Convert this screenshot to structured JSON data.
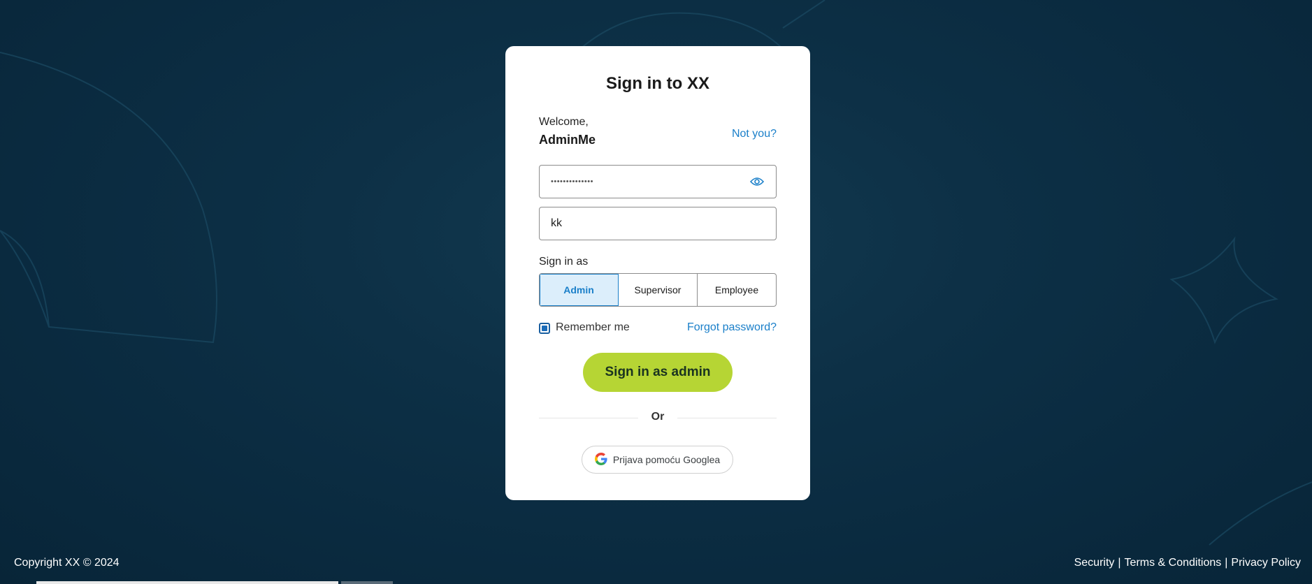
{
  "card": {
    "title": "Sign in to XX",
    "welcome_label": "Welcome,",
    "username": "AdminMe",
    "not_you": "Not you?",
    "password_value": "••••••••••••••",
    "code_value": "kk",
    "signin_as_label": "Sign in as",
    "roles": [
      {
        "label": "Admin",
        "active": true
      },
      {
        "label": "Supervisor",
        "active": false
      },
      {
        "label": "Employee",
        "active": false
      }
    ],
    "remember_label": "Remember me",
    "remember_checked": true,
    "forgot_label": "Forgot password?",
    "primary_button": "Sign in as admin",
    "divider_label": "Or",
    "google_button": "Prijava pomoću Googlea"
  },
  "footer": {
    "copyright": "Copyright XX © 2024",
    "links": [
      "Security",
      "Terms & Conditions",
      "Privacy Policy"
    ],
    "separator": "|"
  },
  "colors": {
    "background": "#0d3046",
    "accent_blue": "#1a7fc9",
    "primary_green": "#b6d534"
  },
  "icons": [
    "eye-icon",
    "google-icon"
  ]
}
